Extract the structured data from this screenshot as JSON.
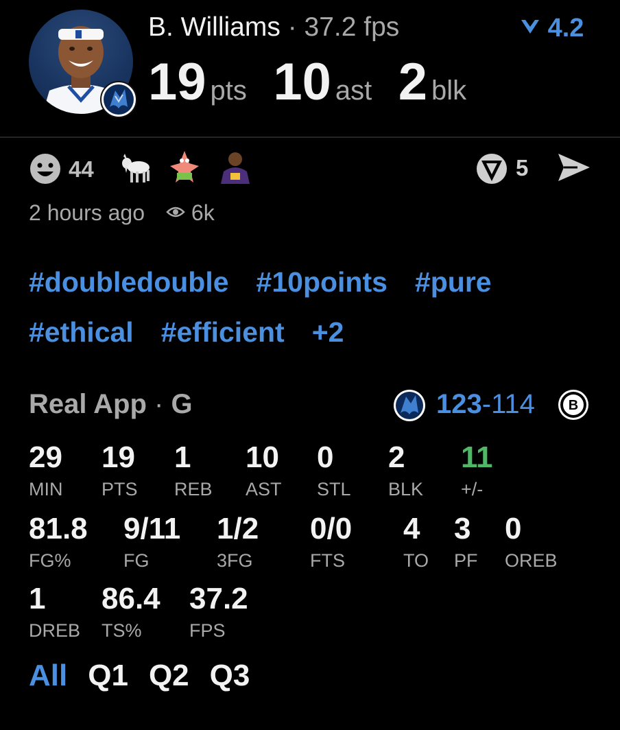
{
  "header": {
    "player_name": "B. Williams",
    "separator": "·",
    "fps_text": "37.2 fps",
    "trend_value": "4.2",
    "stats": [
      {
        "value": "19",
        "unit": "pts"
      },
      {
        "value": "10",
        "unit": "ast"
      },
      {
        "value": "2",
        "unit": "blk"
      }
    ]
  },
  "social": {
    "emoji_count": "44",
    "share_count": "5",
    "time_ago": "2 hours ago",
    "views": "6k"
  },
  "tags": [
    "#doubledouble",
    "#10points",
    "#pure",
    "#ethical",
    "#efficient",
    "+2"
  ],
  "game": {
    "source": "Real App",
    "separator": "·",
    "position": "G",
    "home_score": "123",
    "dash": "-",
    "away_score": "114"
  },
  "box": {
    "row1": [
      {
        "value": "29",
        "label": "MIN"
      },
      {
        "value": "19",
        "label": "PTS"
      },
      {
        "value": "1",
        "label": "REB"
      },
      {
        "value": "10",
        "label": "AST"
      },
      {
        "value": "0",
        "label": "STL"
      },
      {
        "value": "2",
        "label": "BLK"
      },
      {
        "value": "11",
        "label": "+/-"
      }
    ],
    "row2": [
      {
        "value": "81.8",
        "label": "FG%"
      },
      {
        "value": "9/11",
        "label": "FG"
      },
      {
        "value": "1/2",
        "label": "3FG"
      },
      {
        "value": "0/0",
        "label": "FTS"
      },
      {
        "value": "4",
        "label": "TO"
      },
      {
        "value": "3",
        "label": "PF"
      },
      {
        "value": "0",
        "label": "OREB"
      }
    ],
    "row3": [
      {
        "value": "1",
        "label": "DREB"
      },
      {
        "value": "86.4",
        "label": "TS%"
      },
      {
        "value": "37.2",
        "label": "FPS"
      }
    ]
  },
  "tabs": [
    "All",
    "Q1",
    "Q2",
    "Q3"
  ],
  "colors": {
    "accent": "#4a8fe0",
    "positive": "#4fb866",
    "muted": "#a9a9a9"
  }
}
